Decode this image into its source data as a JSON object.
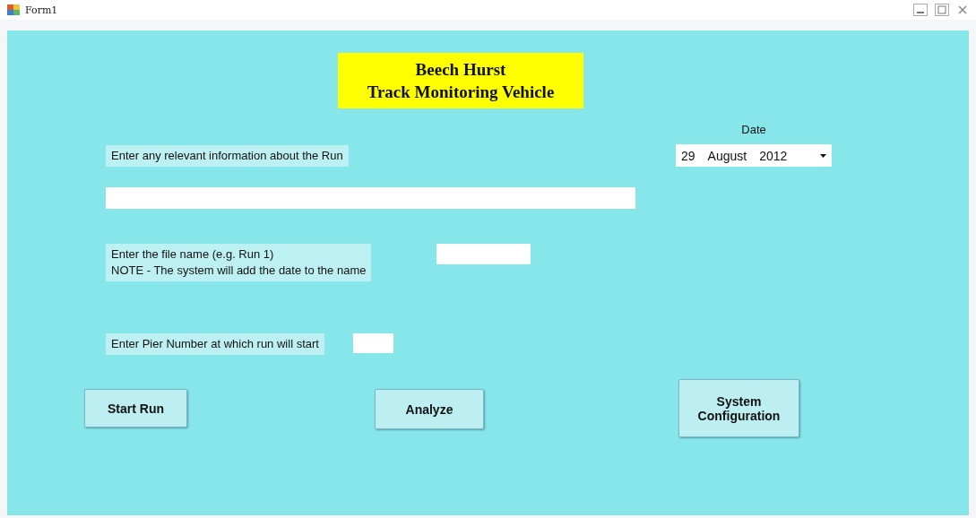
{
  "window": {
    "title": "Form1"
  },
  "banner": {
    "lines": [
      "Beech Hurst",
      "Track Monitoring Vehicle"
    ]
  },
  "date": {
    "label": "Date",
    "day": "29",
    "month": "August",
    "year": "2012"
  },
  "info": {
    "label": "Enter any relevant information about the Run"
  },
  "file": {
    "label_lines": [
      "Enter the file name (e.g. Run 1)",
      "NOTE - The system will add the date to the name"
    ]
  },
  "pier": {
    "label": "Enter Pier Number at which run will start"
  },
  "buttons": [
    {
      "kind": "start",
      "label": "Start Run"
    },
    {
      "kind": "analyze",
      "label": "Analyze"
    },
    {
      "kind": "config",
      "label": "System Configuration"
    }
  ]
}
